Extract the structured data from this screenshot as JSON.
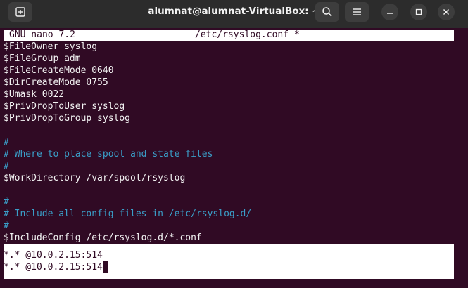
{
  "window": {
    "title": "alumnat@alumnat-VirtualBox: ~",
    "icons": {
      "new_tab": "new-tab-icon",
      "search": "search-icon",
      "menu": "hamburger-menu-icon",
      "minimize": "minimize-icon",
      "maximize": "maximize-icon",
      "close": "close-icon"
    }
  },
  "nano": {
    "version": "GNU nano 7.2",
    "filename": "/etc/rsyslog.conf *"
  },
  "lines": [
    {
      "text": "$FileOwner syslog",
      "type": "code"
    },
    {
      "text": "$FileGroup adm",
      "type": "code"
    },
    {
      "text": "$FileCreateMode 0640",
      "type": "code"
    },
    {
      "text": "$DirCreateMode 0755",
      "type": "code"
    },
    {
      "text": "$Umask 0022",
      "type": "code"
    },
    {
      "text": "$PrivDropToUser syslog",
      "type": "code"
    },
    {
      "text": "$PrivDropToGroup syslog",
      "type": "code"
    },
    {
      "text": "",
      "type": "code"
    },
    {
      "text": "#",
      "type": "comment"
    },
    {
      "text": "# Where to place spool and state files",
      "type": "comment"
    },
    {
      "text": "#",
      "type": "comment"
    },
    {
      "text": "$WorkDirectory /var/spool/rsyslog",
      "type": "code"
    },
    {
      "text": "",
      "type": "code"
    },
    {
      "text": "#",
      "type": "comment"
    },
    {
      "text": "# Include all config files in /etc/rsyslog.d/",
      "type": "comment"
    },
    {
      "text": "#",
      "type": "comment"
    },
    {
      "text": "$IncludeConfig /etc/rsyslog.d/*.conf",
      "type": "code"
    }
  ],
  "selected_lines": [
    "*.* @10.0.2.15:514",
    "*.* @10.0.2.15:514"
  ],
  "colors": {
    "terminal_bg": "#300a24",
    "titlebar_bg": "#2c2c2c",
    "comment": "#3a9ec8",
    "text": "#f2f2f2"
  }
}
